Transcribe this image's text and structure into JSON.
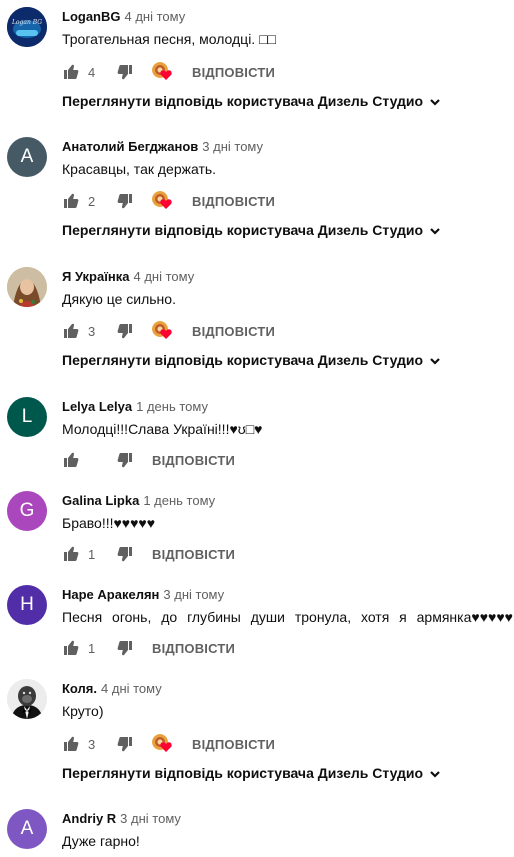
{
  "reply_label": "ВІДПОВІСТИ",
  "comments": [
    {
      "author": "LoganBG",
      "time": "4 дні тому",
      "text": "Трогательная песня, молодці. □□",
      "likes": "4",
      "avatar_icon": "loganbg-logo-avatar",
      "avatar_text": "Logan BG",
      "replies_label": "Переглянути відповідь користувача Дизель Студио"
    },
    {
      "author": "Анатолий Бегджанов",
      "time": "3 дні тому",
      "text": "Красавцы, так держать.",
      "likes": "2",
      "avatar_letter": "А",
      "avatar_color": "#455a64",
      "replies_label": "Переглянути відповідь користувача Дизель Студио"
    },
    {
      "author": "Я Українка",
      "time": "4 дні тому",
      "text": "Дякую це сильно.",
      "likes": "3",
      "avatar_icon": "woman-photo-avatar",
      "replies_label": "Переглянути відповідь користувача Дизель Студио"
    },
    {
      "author": "Lelya Lelya",
      "time": "1 день тому",
      "text": "Молодці!!!Слава Україні!!!♥ʊ□♥",
      "likes": "",
      "avatar_letter": "L",
      "avatar_color": "#00574b"
    },
    {
      "author": "Galina Lipka",
      "time": "1 день тому",
      "text": "Браво!!!♥♥♥♥♥",
      "likes": "1",
      "avatar_letter": "G",
      "avatar_color": "#ab47bc"
    },
    {
      "author": "Наре Аракелян",
      "time": "3 дні тому",
      "text": "Песня огонь, до глубины души тронула, хотя я армянка♥♥♥♥♥",
      "likes": "1",
      "avatar_letter": "H",
      "avatar_color": "#512da8"
    },
    {
      "author": "Коля.",
      "time": "4 дні тому",
      "text": "Круто)",
      "likes": "3",
      "avatar_icon": "gorilla-tuxedo-avatar",
      "replies_label": "Переглянути відповідь користувача Дизель Студио"
    },
    {
      "author": "Andriy R",
      "time": "3 дні тому",
      "text": "Дуже гарно!",
      "avatar_letter": "A",
      "avatar_color": "#7e57c2"
    }
  ]
}
